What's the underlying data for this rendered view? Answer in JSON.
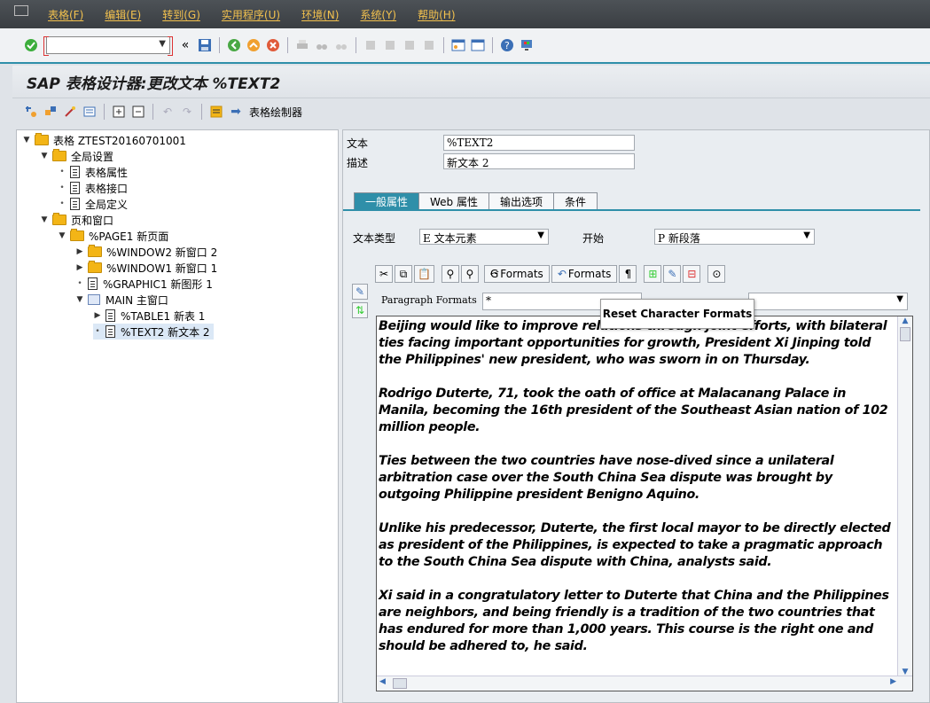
{
  "menu": [
    "表格(F)",
    "编辑(E)",
    "转到(G)",
    "实用程序(U)",
    "环境(N)",
    "系统(Y)",
    "帮助(H)"
  ],
  "title": "SAP 表格设计器:更改文本 %TEXT2",
  "toolbar2": {
    "form_painter_label": "表格绘制器"
  },
  "tree": {
    "root": "表格 ZTEST20160701001",
    "global_settings": "全局设置",
    "form_attributes": "表格属性",
    "form_interface": "表格接口",
    "global_definitions": "全局定义",
    "pages_windows": "页和窗口",
    "page1": "%PAGE1 新页面",
    "window2": "%WINDOW2 新窗口 2",
    "window1": "%WINDOW1 新窗口 1",
    "graphic1": "%GRAPHIC1 新图形 1",
    "main": "MAIN 主窗口",
    "table1": "%TABLE1 新表 1",
    "text2": "%TEXT2 新文本 2"
  },
  "details": {
    "text_label": "文本",
    "text_value": "%TEXT2",
    "desc_label": "描述",
    "desc_value": "新文本 2"
  },
  "tabs": [
    "一般属性",
    "Web 属性",
    "输出选项",
    "条件"
  ],
  "general": {
    "text_type_label": "文本类型",
    "text_type_value": "E 文本元素",
    "start_label": "开始",
    "start_value": "P 新段落"
  },
  "editor_toolbar": {
    "formats1": "Formats",
    "formats2": "Formats",
    "paragraph_formats_label": "Paragraph Formats",
    "paragraph_formats_value": "*"
  },
  "tooltip": "Reset Character Formats",
  "editor_text": [
    "Beijing would like to improve relations through joint efforts, with bilateral ties facing important opportunities for growth, President Xi Jinping told the Philippines' new president, who was sworn in on Thursday.",
    "Rodrigo Duterte, 71, took the oath of office at Malacanang Palace in Manila, becoming the 16th president of the Southeast Asian nation of 102 million people.",
    "Ties between the two countries have nose-dived since a unilateral arbitration case over the South China Sea dispute was brought by outgoing Philippine president Benigno Aquino.",
    "Unlike his predecessor, Duterte, the first local mayor to be directly elected as president of the Philippines, is expected to take a pragmatic approach to the South China Sea dispute with China, analysts said.",
    "Xi said in a congratulatory letter to Duterte that China and the Philippines are neighbors, and being friendly is a tradition of the two countries that has endured for more than 1,000 years. This course is the right one and should be adhered to, he said."
  ]
}
